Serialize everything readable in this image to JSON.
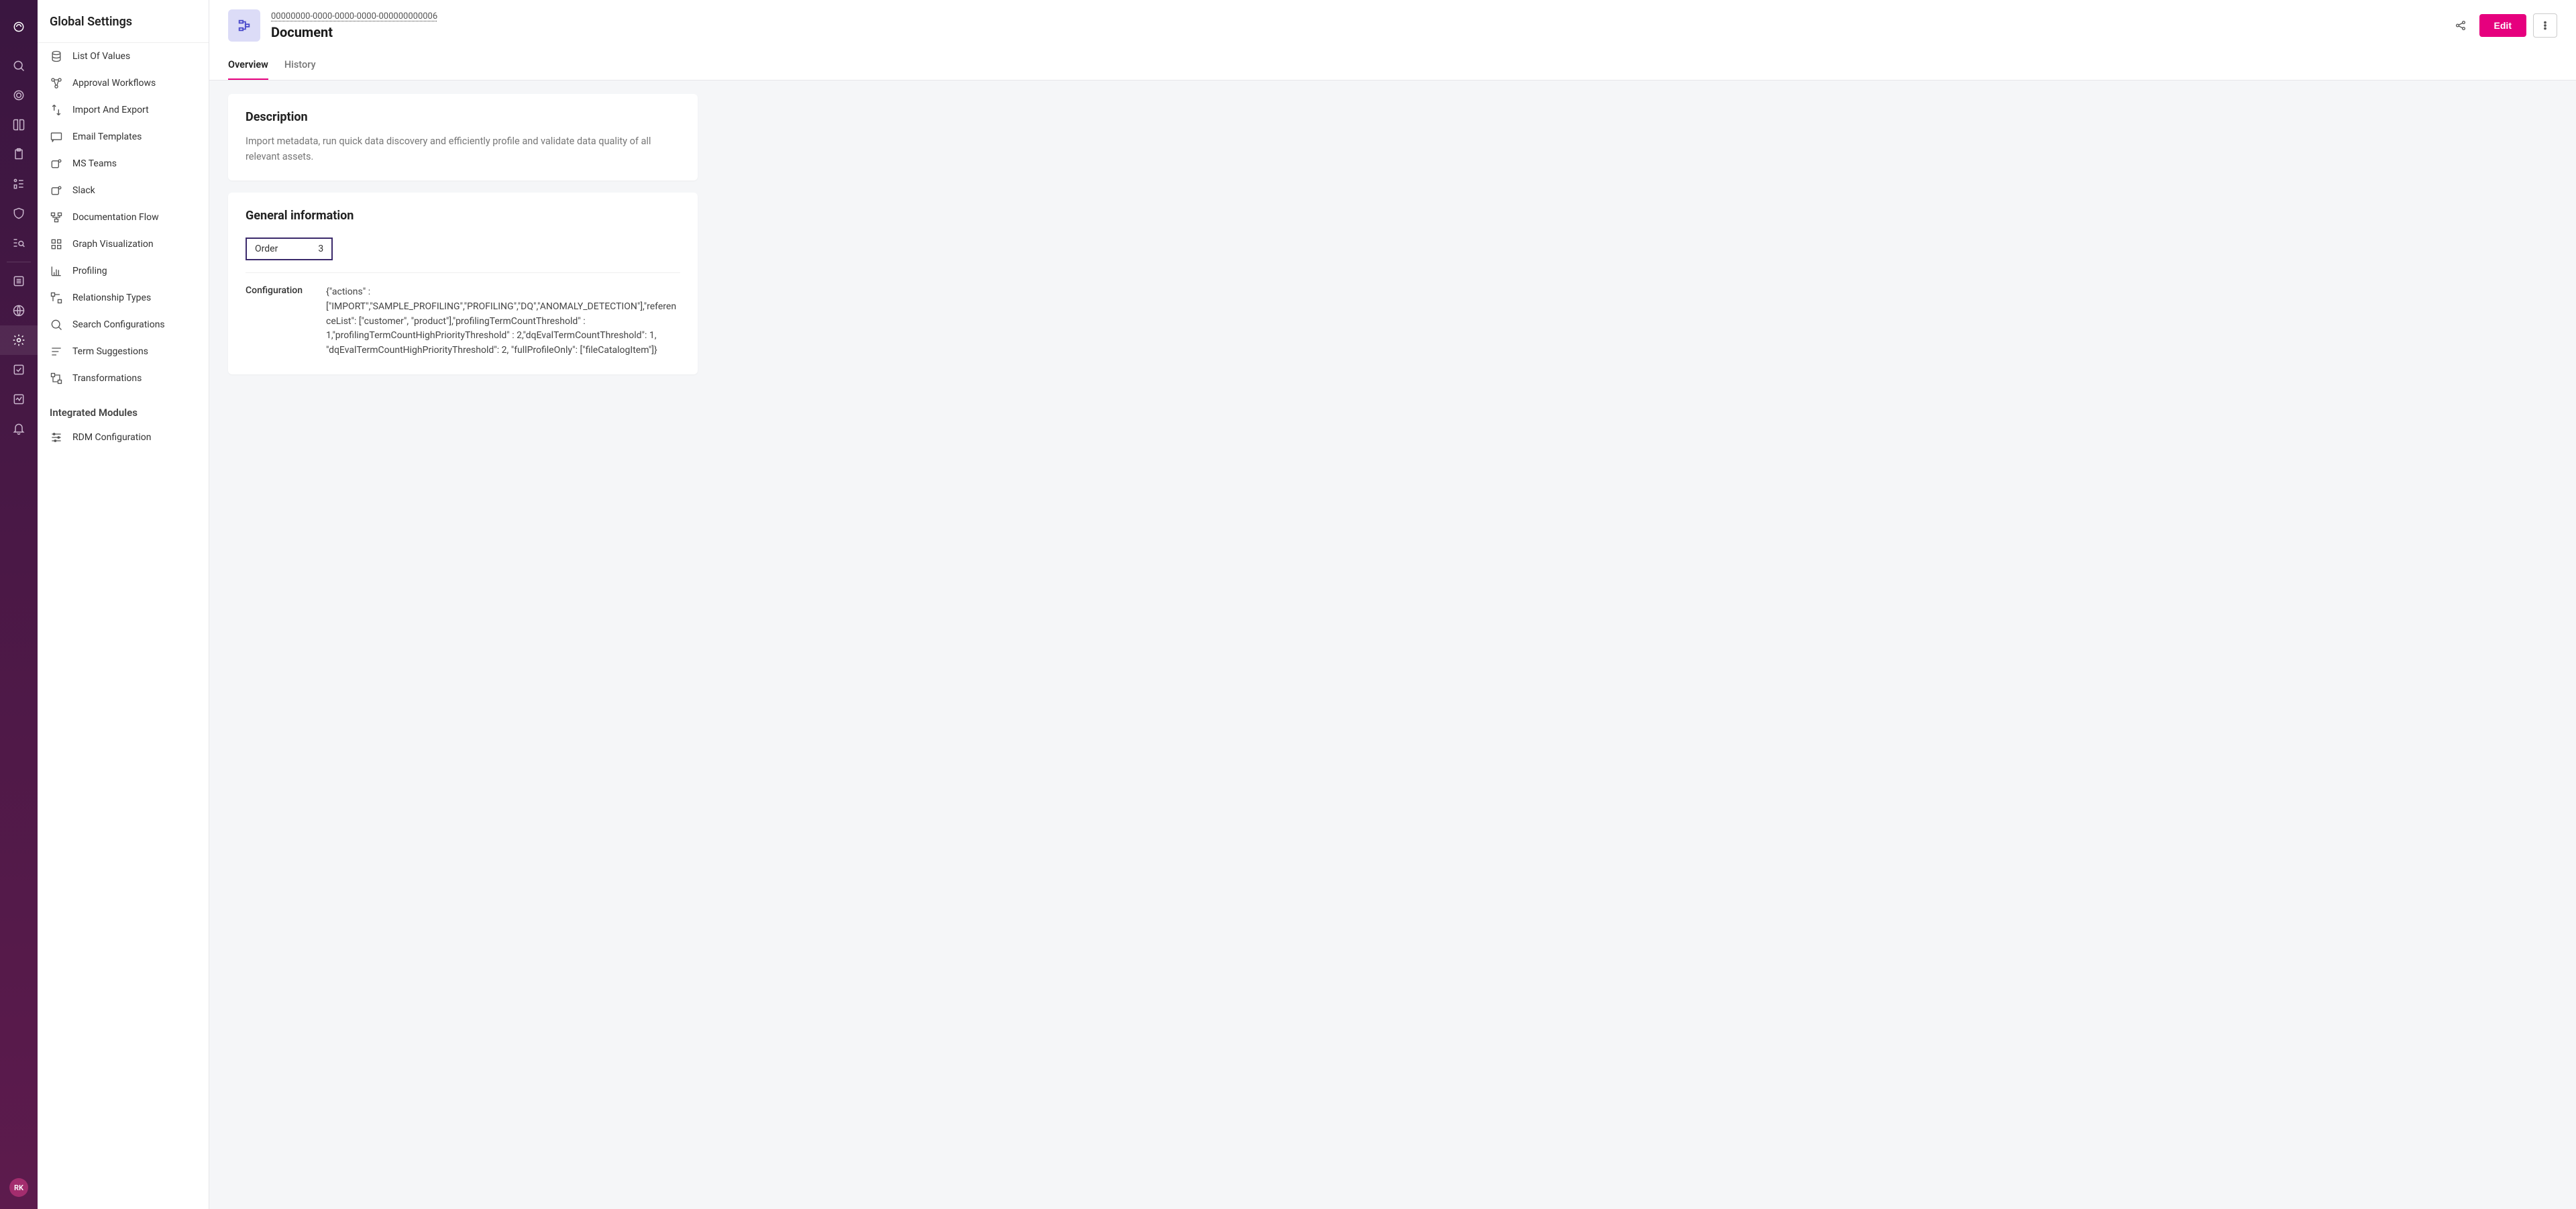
{
  "sidebar": {
    "title": "Global Settings",
    "items": [
      {
        "label": "List Of Values"
      },
      {
        "label": "Approval Workflows"
      },
      {
        "label": "Import And Export"
      },
      {
        "label": "Email Templates"
      },
      {
        "label": "MS Teams"
      },
      {
        "label": "Slack"
      },
      {
        "label": "Documentation Flow"
      },
      {
        "label": "Graph Visualization"
      },
      {
        "label": "Profiling"
      },
      {
        "label": "Relationship Types"
      },
      {
        "label": "Search Configurations"
      },
      {
        "label": "Term Suggestions"
      },
      {
        "label": "Transformations"
      }
    ],
    "section2_title": "Integrated Modules",
    "section2_items": [
      {
        "label": "RDM Configuration"
      }
    ]
  },
  "header": {
    "uuid": "00000000-0000-0000-0000-000000000006",
    "title": "Document",
    "edit_label": "Edit"
  },
  "tabs": [
    {
      "label": "Overview",
      "active": true
    },
    {
      "label": "History",
      "active": false
    }
  ],
  "description_card": {
    "title": "Description",
    "text": "Import metadata, run quick data discovery and efficiently profile and validate data quality of all relevant assets."
  },
  "general_card": {
    "title": "General information",
    "order_label": "Order",
    "order_value": "3",
    "config_label": "Configuration",
    "config_value": "{\"actions\" : [\"IMPORT\",\"SAMPLE_PROFILING\",\"PROFILING\",\"DQ\",\"ANOMALY_DETECTION\"],\"referenceList\": [\"customer\", \"product\"],\"profilingTermCountThreshold\" : 1,\"profilingTermCountHighPriorityThreshold\" : 2,\"dqEvalTermCountThreshold\": 1, \"dqEvalTermCountHighPriorityThreshold\": 2, \"fullProfileOnly\": [\"fileCatalogItem\"]}"
  },
  "avatar": {
    "initials": "RK"
  }
}
